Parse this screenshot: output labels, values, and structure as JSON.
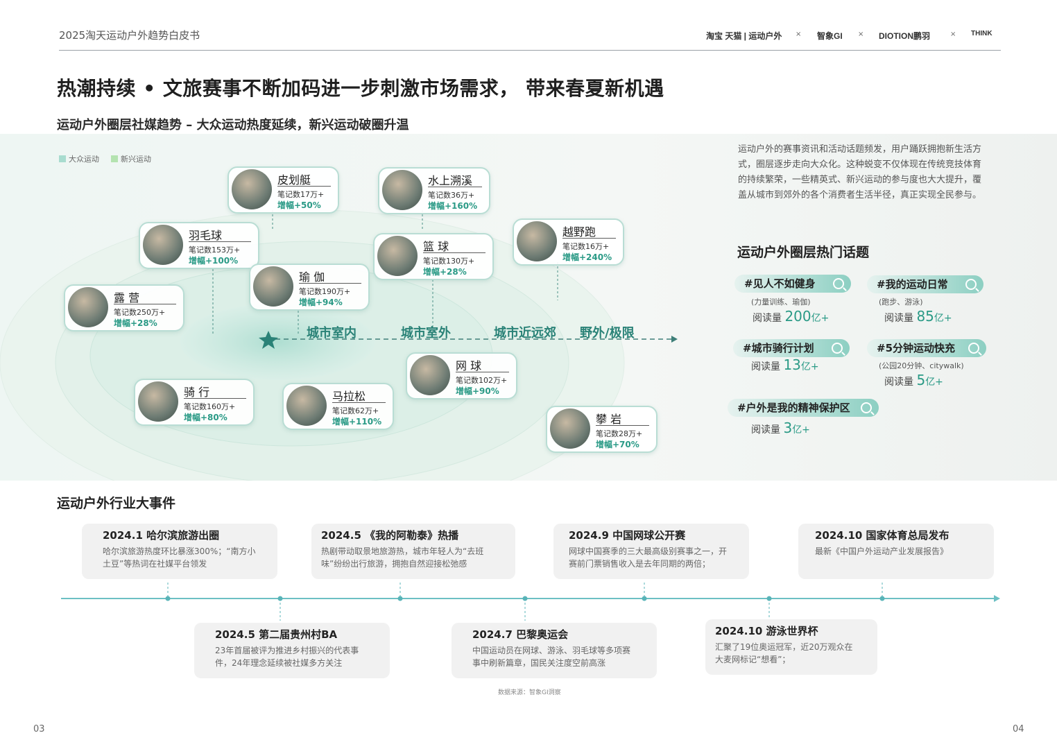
{
  "header": {
    "report_title": "2025淘天运动户外趋势白皮书",
    "logos": [
      "淘宝 天猫 | 运动户外",
      "智象GI",
      "DIOTION鹏羽",
      "THINK"
    ],
    "separator": "×"
  },
  "main_title": "热潮持续 • 文旅赛事不断加码进一步刺激市场需求， 带来春夏新机遇",
  "sub_title": "运动户外圈层社媒趋势 – 大众运动热度延续，新兴运动破圈升温",
  "legend": [
    {
      "label": "大众运动",
      "color": "#a8dccf"
    },
    {
      "label": "新兴运动",
      "color": "#b4e3b0"
    }
  ],
  "axis_labels": [
    "城市室内",
    "城市室外",
    "城市近远郊",
    "野外/极限"
  ],
  "sports": [
    {
      "name": "皮划艇",
      "notes": "笔记数17万+",
      "growth": "增幅+50%"
    },
    {
      "name": "水上溯溪",
      "notes": "笔记数36万+",
      "growth": "增幅+160%"
    },
    {
      "name": "羽毛球",
      "notes": "笔记数153万+",
      "growth": "增幅+100%"
    },
    {
      "name": "篮 球",
      "notes": "笔记数130万+",
      "growth": "增幅+28%"
    },
    {
      "name": "越野跑",
      "notes": "笔记数16万+",
      "growth": "增幅+240%"
    },
    {
      "name": "瑜 伽",
      "notes": "笔记数190万+",
      "growth": "增幅+94%"
    },
    {
      "name": "露 营",
      "notes": "笔记数250万+",
      "growth": "增幅+28%"
    },
    {
      "name": "网 球",
      "notes": "笔记数102万+",
      "growth": "增幅+90%"
    },
    {
      "name": "骑 行",
      "notes": "笔记数160万+",
      "growth": "增幅+80%"
    },
    {
      "name": "马拉松",
      "notes": "笔记数62万+",
      "growth": "增幅+110%"
    },
    {
      "name": "攀 岩",
      "notes": "笔记数28万+",
      "growth": "增幅+70%"
    }
  ],
  "paragraph": "运动户外的赛事资讯和活动话题频发，用户踊跃拥抱新生活方式，圈层逐步走向大众化。这种蜕变不仅体现在传统竞技体育的持续繁荣，一些精英式、新兴运动的参与度也大大提升，覆盖从城市到郊外的各个消费者生活半径，真正实现全民参与。",
  "topics_title": "运动户外圈层热门话题",
  "topics": [
    {
      "tag": "#见人不如健身",
      "sub": "(力量训练、瑜伽)",
      "read_label": "阅读量",
      "read_value": "200",
      "read_unit": "亿+"
    },
    {
      "tag": "#我的运动日常",
      "sub": "(跑步、游泳)",
      "read_label": "阅读量",
      "read_value": "85",
      "read_unit": "亿+"
    },
    {
      "tag": "#城市骑行计划",
      "sub": "",
      "read_label": "阅读量",
      "read_value": "13",
      "read_unit": "亿+"
    },
    {
      "tag": "#5分钟运动快充",
      "sub": "(公园20分钟、citywalk)",
      "read_label": "阅读量",
      "read_value": "5",
      "read_unit": "亿+"
    },
    {
      "tag": "#户外是我的精神保护区",
      "sub": "",
      "read_label": "阅读量",
      "read_value": "3",
      "read_unit": "亿+"
    }
  ],
  "events_title": "运动户外行业大事件",
  "events": [
    {
      "title": "2024.1 哈尔滨旅游出圈",
      "desc": "哈尔滨旅游热度环比暴涨300%；“南方小土豆”等热词在社媒平台领发"
    },
    {
      "title": "2024.5 第二届贵州村BA",
      "desc": "23年首届被评为推进乡村振兴的代表事件，24年理念延续被社媒多方关注"
    },
    {
      "title": "2024.5 《我的阿勒泰》热播",
      "desc": "热剧带动取景地旅游热，城市年轻人为“去班味”纷纷出行旅游，拥抱自然迎接松弛感"
    },
    {
      "title": "2024.7 巴黎奥运会",
      "desc": "中国运动员在网球、游泳、羽毛球等多项赛事中刷新篇章，国民关注度空前高涨"
    },
    {
      "title": "2024.9 中国网球公开赛",
      "desc": "网球中国赛季的三大最高级别赛事之一，开赛前门票销售收入是去年同期的两倍；"
    },
    {
      "title": "2024.10 游泳世界杯",
      "desc": "汇聚了19位奥运冠军，近20万观众在大麦网标记“想看”；"
    },
    {
      "title": "2024.10 国家体育总局发布",
      "desc": "最新《中国户外运动产业发展报告》"
    }
  ],
  "source": "数据来源：智象GI洞察",
  "page_left": "03",
  "page_right": "04"
}
